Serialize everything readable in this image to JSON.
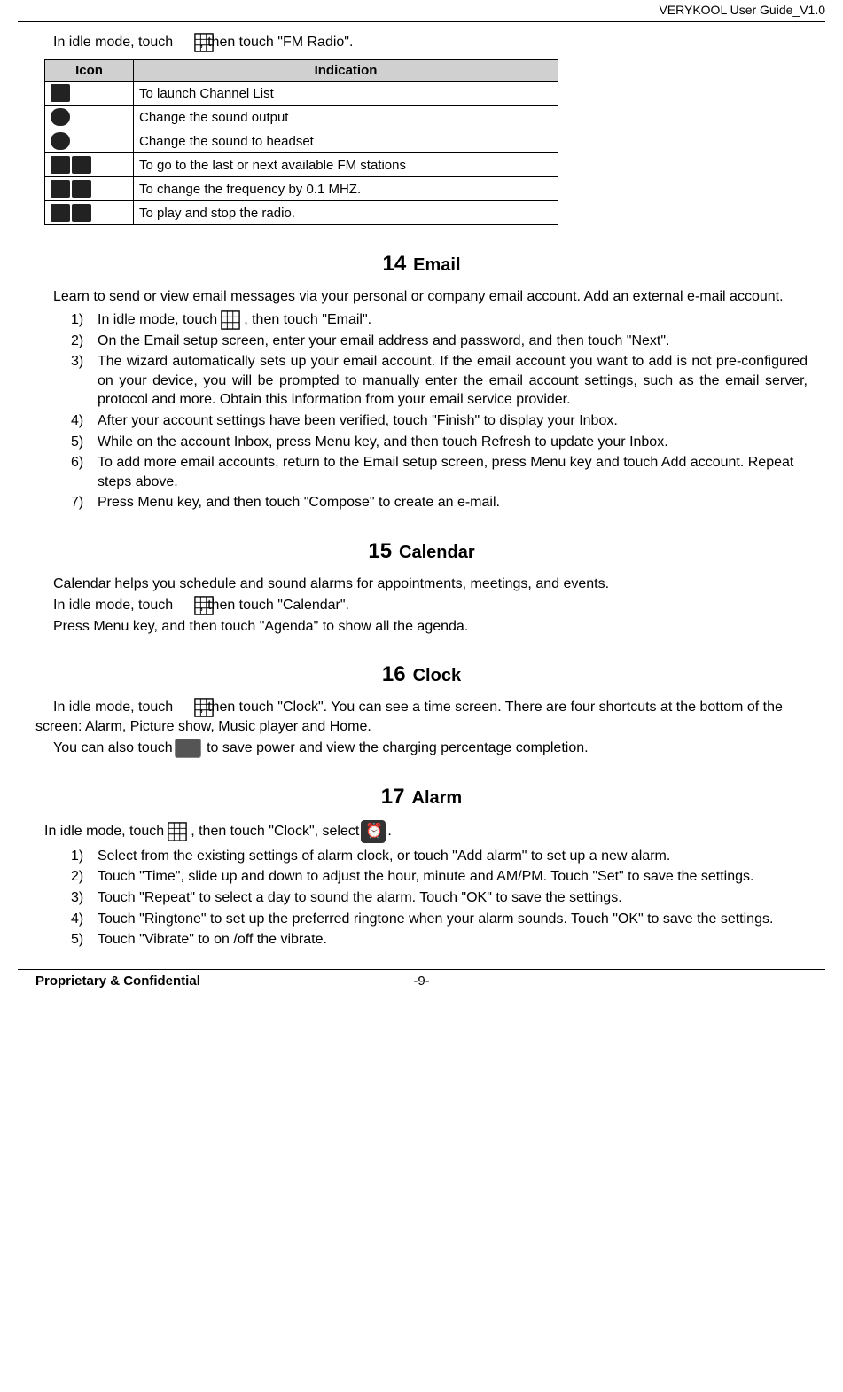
{
  "header": {
    "right": "VERYKOOL  User Guide_V1.0"
  },
  "fm": {
    "intro_before": "In idle mode, touch",
    "intro_after": ", then touch \"FM Radio\".",
    "table": {
      "col1": "Icon",
      "col2": "Indication",
      "rows": [
        "To launch Channel List",
        "Change the sound output",
        "Change the sound to headset",
        "To go to the last or next available FM stations",
        "To change the frequency by 0.1 MHZ.",
        "To play and stop the radio."
      ]
    }
  },
  "email": {
    "num": "14",
    "title": "Email",
    "intro": "Learn to send or view email messages via your personal or company email account. Add an external e-mail account.",
    "items": [
      {
        "n": "1)",
        "before": "In idle mode, touch",
        "after": ", then touch \"Email\"."
      },
      {
        "n": "2)",
        "text": "On the Email setup screen, enter your email address and password, and then touch \"Next\"."
      },
      {
        "n": "3)",
        "text": "The wizard automatically sets up your email account. If the email account you want to add is not pre-configured on your device, you will be prompted to manually enter the email account settings, such as the email server, protocol and more. Obtain this information from your email service provider."
      },
      {
        "n": "4)",
        "text": "After your account settings have been verified, touch \"Finish\" to display your Inbox."
      },
      {
        "n": "5)",
        "text": "While on the account Inbox, press Menu key, and then touch Refresh to update your Inbox."
      },
      {
        "n": "6)",
        "text": "To add more email accounts, return to the Email setup screen, press Menu key and touch Add account. Repeat steps above."
      },
      {
        "n": "7)",
        "text": "Press Menu key, and then touch \"Compose\" to create an e-mail."
      }
    ]
  },
  "calendar": {
    "num": "15",
    "title": "Calendar",
    "line1": "Calendar helps you schedule and sound alarms for appointments, meetings, and events.",
    "line2_before": "In idle mode, touch",
    "line2_after": ", then touch \"Calendar\".",
    "line3": "Press Menu key, and then touch \"Agenda\" to show all the agenda."
  },
  "clock": {
    "num": "16",
    "title": "Clock",
    "line1_before": "In idle mode, touch",
    "line1_after": ", then touch \"Clock\". You can see a time screen. There are four shortcuts at the bottom of the screen: Alarm, Picture show, Music player and Home.",
    "line2_before": "You can also touch",
    "line2_after": " to save power and view the charging percentage completion."
  },
  "alarm": {
    "num": "17",
    "title": "Alarm",
    "intro_before": "In idle mode, touch",
    "intro_mid": ", then touch \"Clock\", select",
    "intro_after": ".",
    "items": [
      {
        "n": "1)",
        "text": "Select from the existing settings of alarm clock, or touch \"Add alarm\" to set up a new alarm."
      },
      {
        "n": "2)",
        "text": "Touch \"Time\", slide up and down to adjust the hour, minute and AM/PM. Touch \"Set\" to save the settings."
      },
      {
        "n": "3)",
        "text": "Touch \"Repeat\" to select a day to sound the alarm. Touch \"OK\" to save the settings."
      },
      {
        "n": "4)",
        "text": "Touch \"Ringtone\" to set up the preferred ringtone when your alarm sounds. Touch \"OK\" to save the settings."
      },
      {
        "n": "5)",
        "text": "Touch \"Vibrate\" to on /off the vibrate."
      }
    ]
  },
  "footer": {
    "left": "Proprietary & Confidential",
    "center": "-9-"
  }
}
